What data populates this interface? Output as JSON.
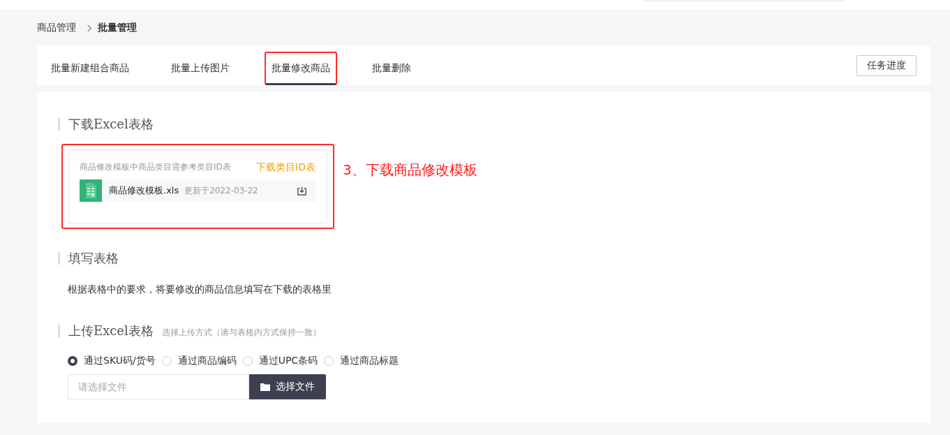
{
  "breadcrumb": [
    {
      "label": "商品管理",
      "current": false
    },
    {
      "label": "批量管理",
      "current": true
    }
  ],
  "tabs": [
    {
      "label": "批量新建组合商品",
      "selected": false,
      "highlighted": false
    },
    {
      "label": "批量上传图片",
      "selected": false,
      "highlighted": false
    },
    {
      "label": "批量修改商品",
      "selected": true,
      "highlighted": true
    },
    {
      "label": "批量删除",
      "selected": false,
      "highlighted": false
    }
  ],
  "task_button": "任务进度",
  "download_section": {
    "title": "下载Excel表格",
    "card": {
      "highlighted": true,
      "hint": "商品修改模板中商品类目需参考类目ID表",
      "link": "下载类目ID表",
      "file_name": "商品修改模板.xls",
      "updated": "更新于2022-03-22"
    },
    "annotation": "3、下载商品修改模板"
  },
  "fill_section": {
    "title": "填写表格",
    "description": "根据表格中的要求，将要修改的商品信息填写在下载的表格里"
  },
  "upload_section": {
    "title": "上传Excel表格",
    "subtitle": "选择上传方式（请与表格内方式保持一致）",
    "options": [
      {
        "label": "通过SKU码/货号",
        "selected": true
      },
      {
        "label": "通过商品编码",
        "selected": false
      },
      {
        "label": "通过UPC条码",
        "selected": false
      },
      {
        "label": "通过商品标题",
        "selected": false
      }
    ],
    "file_field": {
      "placeholder": "请选择文件"
    },
    "choose_button": "选择文件"
  }
}
